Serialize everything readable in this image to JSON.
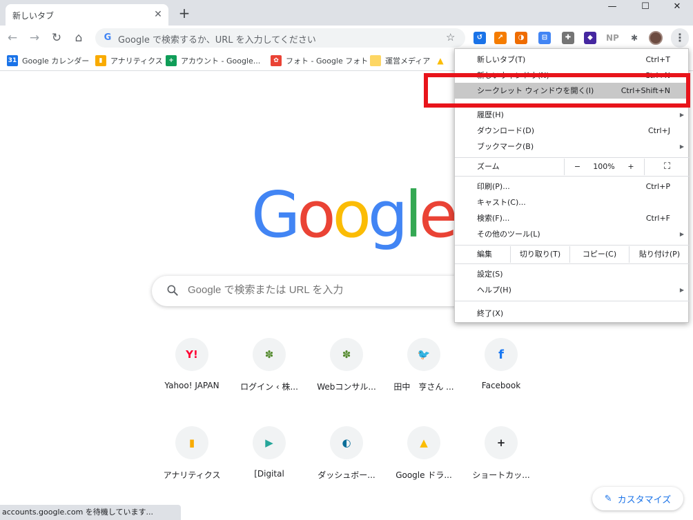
{
  "tab": {
    "title": "新しいタブ",
    "close": "✕",
    "new": "+"
  },
  "window": {
    "minimize": "—",
    "maximize": "☐",
    "close": "✕"
  },
  "toolbar": {
    "back": "←",
    "forward": "→",
    "reload": "↻",
    "home": "⌂",
    "omnibox_placeholder": "Google で検索するか、URL を入力してください",
    "star": "☆",
    "extensions": [
      {
        "name": "ext-blue-icon",
        "glyph": "↺",
        "color": "#1a73e8"
      },
      {
        "name": "ext-chart-icon",
        "glyph": "↗",
        "color": "#f57c00"
      },
      {
        "name": "ext-swirl-icon",
        "glyph": "◑",
        "color": "#ef6c00"
      },
      {
        "name": "ext-card-icon",
        "glyph": "⊟",
        "color": "#4285f4"
      },
      {
        "name": "ext-puzzle-gray-icon",
        "glyph": "✚",
        "color": "#757575"
      },
      {
        "name": "ext-cube-icon",
        "glyph": "◆",
        "color": "#4527a0"
      },
      {
        "name": "ext-np-icon",
        "glyph": "NP",
        "color": "#9e9e9e"
      },
      {
        "name": "extensions-puzzle-icon",
        "glyph": "✱",
        "color": "#5f6368"
      }
    ],
    "kebab": "⋮"
  },
  "bookmarks": [
    {
      "label": "Google カレンダー",
      "icon": "31",
      "color": "#1a73e8"
    },
    {
      "label": "アナリティクス",
      "icon": "▮",
      "color": "#f9ab00"
    },
    {
      "label": "アカウント - Google...",
      "icon": "+",
      "color": "#0f9d58"
    },
    {
      "label": "フォト - Google フォト",
      "icon": "✿",
      "color": "#ea4335"
    },
    {
      "label": "運営メディア",
      "icon": "",
      "color": "#fdd663"
    }
  ],
  "logo": [
    "G",
    "o",
    "o",
    "g",
    "l",
    "e"
  ],
  "logo_colors": [
    "#4285f4",
    "#ea4335",
    "#fbbc05",
    "#4285f4",
    "#34a853",
    "#ea4335"
  ],
  "search": {
    "placeholder": "Google で検索または URL を入力"
  },
  "tiles": [
    {
      "label": "Yahoo! JAPAN",
      "glyph": "Y!",
      "color": "#ff0033"
    },
    {
      "label": "ログイン ‹ 株...",
      "glyph": "✽",
      "color": "#558b2f"
    },
    {
      "label": "Webコンサル...",
      "glyph": "✽",
      "color": "#558b2f"
    },
    {
      "label": "田中　亨さん ...",
      "glyph": "🐦",
      "color": "#1da1f2"
    },
    {
      "label": "Facebook",
      "glyph": "f",
      "color": "#1877f2"
    },
    {
      "label": "アナリティクス",
      "glyph": "▮",
      "color": "#f9ab00"
    },
    {
      "label": "[Digital",
      "glyph": "▶",
      "color": "#26a69a"
    },
    {
      "label": "ダッシュボー...",
      "glyph": "◐",
      "color": "#0b6e99"
    },
    {
      "label": "Google ドラ...",
      "glyph": "▲",
      "color": "#fbbc04"
    },
    {
      "label": "ショートカッ...",
      "glyph": "+",
      "color": "#202124"
    }
  ],
  "customize": {
    "label": "カスタマイズ",
    "icon": "✎"
  },
  "status": "accounts.google.com を待機しています...",
  "menu": {
    "new_tab": {
      "label": "新しいタブ(T)",
      "shortcut": "Ctrl+T"
    },
    "new_window": {
      "label": "新しいウィンドウ(N)",
      "shortcut": "Ctrl+N"
    },
    "incognito": {
      "label": "シークレット ウィンドウを開く(I)",
      "shortcut": "Ctrl+Shift+N"
    },
    "history": {
      "label": "履歴(H)",
      "arrow": "▶"
    },
    "downloads": {
      "label": "ダウンロード(D)",
      "shortcut": "Ctrl+J"
    },
    "bookmarks": {
      "label": "ブックマーク(B)",
      "arrow": "▶"
    },
    "zoom": {
      "label": "ズーム",
      "minus": "−",
      "value": "100%",
      "plus": "+",
      "fullscreen": "⛶"
    },
    "print": {
      "label": "印刷(P)...",
      "shortcut": "Ctrl+P"
    },
    "cast": {
      "label": "キャスト(C)..."
    },
    "find": {
      "label": "検索(F)...",
      "shortcut": "Ctrl+F"
    },
    "more_tools": {
      "label": "その他のツール(L)",
      "arrow": "▶"
    },
    "edit": {
      "label": "編集",
      "cut": "切り取り(T)",
      "copy": "コピー(C)",
      "paste": "貼り付け(P)"
    },
    "settings": {
      "label": "設定(S)"
    },
    "help": {
      "label": "ヘルプ(H)",
      "arrow": "▶"
    },
    "exit": {
      "label": "終了(X)"
    }
  },
  "annotation": {
    "color": "#e8141b"
  }
}
